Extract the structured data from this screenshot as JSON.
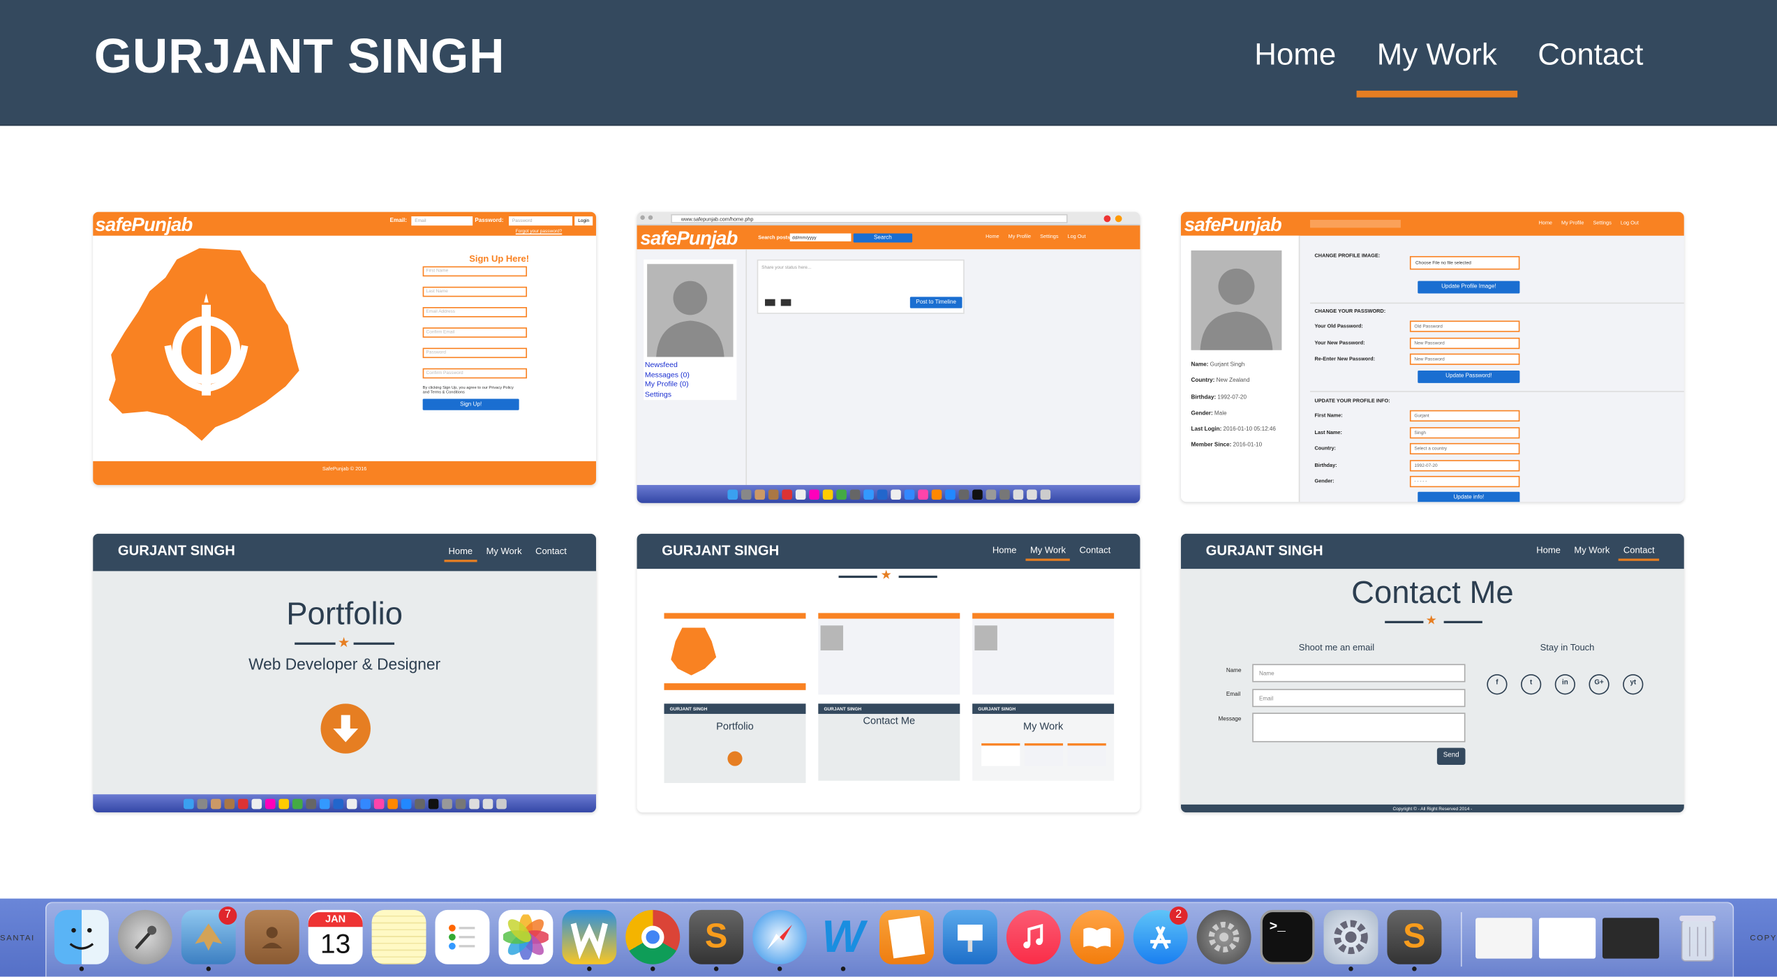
{
  "header": {
    "brand": "GURJANT SINGH",
    "nav": [
      "Home",
      "My Work",
      "Contact"
    ],
    "active_nav": "My Work"
  },
  "tile1": {
    "logo": "safePunjab",
    "email_label": "Email:",
    "email_placeholder": "Email",
    "password_label": "Password:",
    "password_placeholder": "Password",
    "login_button": "Login",
    "forgot_link": "Forgot your password?",
    "signup_title": "Sign Up Here!",
    "fields": [
      "First Name",
      "Last Name",
      "Email Address",
      "Confirm Email",
      "Password",
      "Confirm Password"
    ],
    "terms_text": "By clicking Sign Up, you agree to our Privacy Policy and Terms & Conditions",
    "signup_button": "Sign Up!",
    "footer": "SafePunjab © 2016"
  },
  "tile2": {
    "url": "www.safepunjab.com/home.php",
    "logo": "safePunjab",
    "search_label": "Search posts:",
    "search_value": "dd/mm/yyyy",
    "search_button": "Search",
    "nav": [
      "Home",
      "My Profile",
      "Settings",
      "Log Out"
    ],
    "status_placeholder": "Share your status here...",
    "post_button": "Post to Timeline",
    "side_links": [
      "Newsfeed",
      "Messages (0)",
      "My Profile (0)",
      "Settings"
    ]
  },
  "tile3": {
    "logo": "safePunjab",
    "nav": [
      "Home",
      "My Profile",
      "Settings",
      "Log Out"
    ],
    "profile": [
      {
        "label": "Name:",
        "value": "Gurjant Singh"
      },
      {
        "label": "Country:",
        "value": "New Zealand"
      },
      {
        "label": "Birthday:",
        "value": "1992-07-20"
      },
      {
        "label": "Gender:",
        "value": "Male"
      },
      {
        "label": "Last Login:",
        "value": "2016-01-10 05:12:46"
      },
      {
        "label": "Member Since:",
        "value": "2016-01-10"
      }
    ],
    "change_image_title": "CHANGE PROFILE IMAGE:",
    "choose_file": "Choose File   no file selected",
    "update_image_button": "Update Profile Image!",
    "change_password_title": "CHANGE YOUR PASSWORD:",
    "password_rows": [
      {
        "label": "Your Old Password:",
        "placeholder": "Old Password"
      },
      {
        "label": "Your New Password:",
        "placeholder": "New Password"
      },
      {
        "label": "Re-Enter New Password:",
        "placeholder": "New Password"
      }
    ],
    "update_password_button": "Update Password!",
    "update_info_title": "UPDATE YOUR PROFILE INFO:",
    "info_rows": [
      {
        "label": "First Name:",
        "value": "Gurjant"
      },
      {
        "label": "Last Name:",
        "value": "Singh"
      },
      {
        "label": "Country:",
        "value": "Select a country"
      },
      {
        "label": "Birthday:",
        "value": "1992-07-20"
      },
      {
        "label": "Gender:",
        "value": "- - - - -"
      }
    ],
    "update_info_button": "Update info!"
  },
  "tile4": {
    "brand": "GURJANT SINGH",
    "nav": [
      "Home",
      "My Work",
      "Contact"
    ],
    "title": "Portfolio",
    "subtitle": "Web Developer & Designer"
  },
  "tile5": {
    "brand": "GURJANT SINGH",
    "nav": [
      "Home",
      "My Work",
      "Contact"
    ],
    "thumb_titles": [
      "Portfolio",
      "Contact Me",
      "My Work"
    ]
  },
  "tile6": {
    "brand": "GURJANT SINGH",
    "nav": [
      "Home",
      "My Work",
      "Contact"
    ],
    "title": "Contact Me",
    "email_heading": "Shoot me an email",
    "touch_heading": "Stay in Touch",
    "name_label": "Name",
    "name_placeholder": "Name",
    "email_label": "Email",
    "email_placeholder": "Email",
    "message_label": "Message",
    "send_button": "Send",
    "copyright": "Copyright © - All Right Reserved 2014 -",
    "social_icons": [
      "f",
      "t",
      "in",
      "G+",
      "yt"
    ]
  },
  "dock": {
    "left_label": "SANTAI",
    "right_label": "COPY",
    "calendar_month": "JAN",
    "calendar_day": "13",
    "mail_badge": "7",
    "appstore_badge": "2"
  }
}
